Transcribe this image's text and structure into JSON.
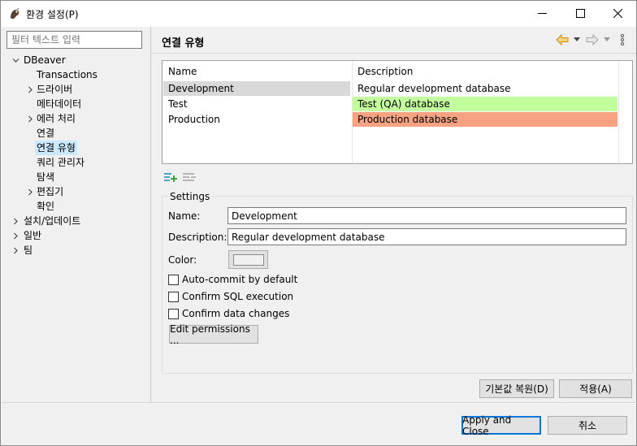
{
  "window": {
    "title": "환경 설정(P)",
    "icons": {
      "app": "dbeaver-beaver-icon",
      "minimize": "minimize-icon",
      "maximize": "maximize-icon",
      "close": "close-icon"
    }
  },
  "filter": {
    "placeholder": "필터 텍스트 입력",
    "value": ""
  },
  "tree": {
    "root": "DBeaver",
    "items": [
      {
        "label": "Transactions",
        "expandable": false
      },
      {
        "label": "드라이버",
        "expandable": true
      },
      {
        "label": "메타데이터",
        "expandable": false
      },
      {
        "label": "에러 처리",
        "expandable": true
      },
      {
        "label": "연결",
        "expandable": false
      },
      {
        "label": "연결 유형",
        "expandable": false,
        "selected": true
      },
      {
        "label": "쿼리 관리자",
        "expandable": false
      },
      {
        "label": "탐색",
        "expandable": false
      },
      {
        "label": "편집기",
        "expandable": true
      },
      {
        "label": "확인",
        "expandable": false
      }
    ],
    "top_level": [
      {
        "label": "설치/업데이트"
      },
      {
        "label": "일반"
      },
      {
        "label": "팀"
      }
    ]
  },
  "page": {
    "title": "연결 유형",
    "nav_icons": [
      "back-arrow-icon",
      "back-dropdown-icon",
      "forward-arrow-icon",
      "forward-dropdown-icon",
      "more-menu-icon"
    ]
  },
  "table": {
    "columns": [
      "Name",
      "Description"
    ],
    "rows": [
      {
        "name": "Development",
        "description": "Regular development database",
        "color": "#ffffff",
        "selected": true
      },
      {
        "name": "Test",
        "description": "Test (QA) database",
        "color": "#c4ff9e"
      },
      {
        "name": "Production",
        "description": "Production database",
        "color": "#f7a281"
      }
    ],
    "tools": [
      "add-type-icon",
      "remove-type-icon"
    ]
  },
  "settings": {
    "title": "Settings",
    "name_label": "Name:",
    "name_value": "Development",
    "description_label": "Description:",
    "description_value": "Regular development database",
    "color_label": "Color:",
    "color_value": "#f0f0f0",
    "checkboxes": [
      {
        "label": "Auto-commit by default",
        "checked": false
      },
      {
        "label": "Confirm SQL execution",
        "checked": false
      },
      {
        "label": "Confirm data changes",
        "checked": false
      }
    ],
    "permissions_button": "Edit permissions ..."
  },
  "page_buttons": {
    "restore_defaults": "기본값 복원(D)",
    "apply": "적용(A)"
  },
  "dialog_buttons": {
    "apply_and_close": "Apply and Close",
    "cancel": "취소"
  },
  "colors": {
    "selection": "#cce8ff",
    "row_selected": "#d9d9d9",
    "accent": "#0078d7",
    "add_icon": "#2a8fbd"
  }
}
